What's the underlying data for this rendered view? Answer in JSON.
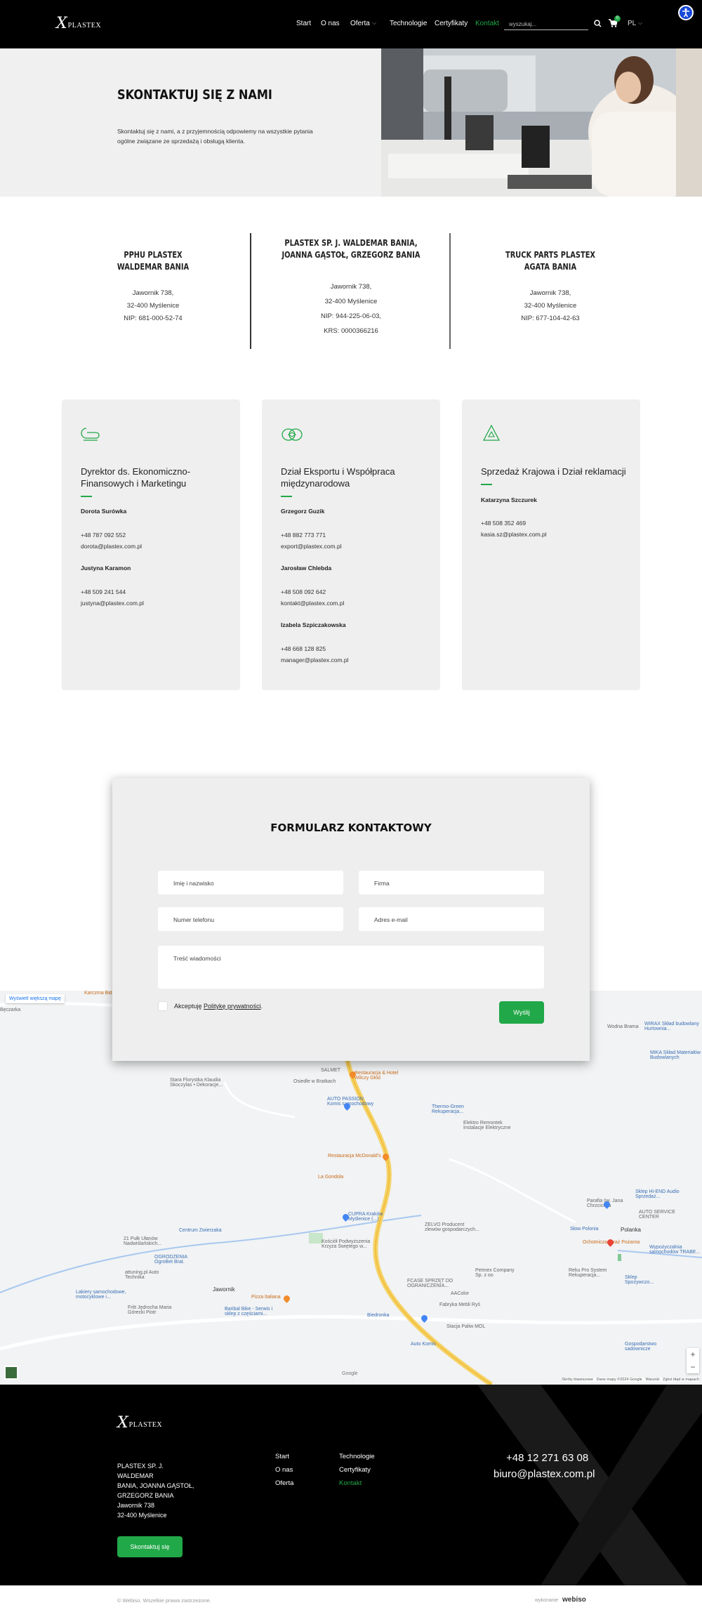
{
  "header": {
    "logo_mark": "X",
    "logo_text": "PLASTEX",
    "nav": [
      "Start",
      "O nas",
      "Oferta",
      "Technologie",
      "Certyfikaty",
      "Kontakt"
    ],
    "search_placeholder": "wyszukaj...",
    "cart_count": "0",
    "lang": "PL"
  },
  "hero": {
    "title": "SKONTAKTUJ SIĘ Z NAMI",
    "text": "Skontaktuj się z nami, a z przyjemnością odpowiemy na wszystkie pytania ogólne związane ze sprzedażą i obsługą klienta."
  },
  "companies": [
    {
      "title": [
        "PPHU PLASTEX",
        "WALDEMAR BANIA"
      ],
      "lines": [
        "Jawornik  738,",
        "32-400 Myślenice",
        "NIP: 681-000-52-74"
      ]
    },
    {
      "title": [
        "PLASTEX SP. J. WALDEMAR BANIA,",
        "JOANNA GĄSTOŁ, GRZEGORZ BANIA"
      ],
      "lines": [
        "Jawornik  738,",
        "32-400 Myślenice",
        "NIP: 944-225-06-03,",
        "KRS: 0000366216"
      ]
    },
    {
      "title": [
        "TRUCK PARTS PLASTEX",
        "AGATA BANIA"
      ],
      "lines": [
        "Jawornik  738,",
        "32-400 Myślenice",
        "NIP: 677-104-42-63"
      ]
    }
  ],
  "departments": [
    {
      "icon": "coin-icon",
      "title": [
        "Dyrektor ds. Ekonomiczno-",
        "Finansowych i Marketingu"
      ],
      "people": [
        {
          "name": "Dorota Surówka",
          "phone": "+48 787 092 552",
          "email": "dorota@plastex.com.pl"
        },
        {
          "name": "Justyna Karamon",
          "phone": "+48 509 241 544",
          "email": "justyna@plastex.com.pl"
        }
      ]
    },
    {
      "icon": "handshake-icon",
      "title": [
        "Dział Eksportu i Współpraca",
        "międzynarodowa"
      ],
      "people": [
        {
          "name": "Grzegorz Guzik",
          "phone": "+48 882 773 771",
          "email": "export@plastex.com.pl"
        },
        {
          "name": "Jarosław Chlebda",
          "phone": "+48 508 092 642",
          "email": "kontakt@plastex.com.pl"
        },
        {
          "name": "Izabela Szpiczakowska",
          "phone": "+48 668 128 825",
          "email": "manager@plastex.com.pl"
        }
      ]
    },
    {
      "icon": "recycle-icon",
      "title": [
        "Sprzedaż Krajowa i Dział reklamacji"
      ],
      "people": [
        {
          "name": "Katarzyna Szczurek",
          "phone": "+48 508 352 469",
          "email": "kasia.sz@plastex.com.pl"
        }
      ]
    }
  ],
  "form": {
    "title": "FORMULARZ KONTAKTOWY",
    "name_ph": "Imię i nazwisko",
    "company_ph": "Firma",
    "phone_ph": "Numer telefonu",
    "email_ph": "Adres e-mail",
    "message_ph": "Treść wiadomości",
    "accept_prefix": "Akceptuję ",
    "accept_link": "Politykę prywatności",
    "accept_suffix": ".",
    "submit": "Wyślij"
  },
  "map": {
    "larger_map": "Wyświetl większą mapę",
    "labels": [
      {
        "t": "Karczma Bid",
        "c": "org"
      },
      {
        "t": "Bęczarka",
        "c": ""
      },
      {
        "t": "SALMET",
        "c": ""
      },
      {
        "t": "Stara Florystka Klaudia Skoczylas • Dekoracje...",
        "c": ""
      },
      {
        "t": "Osiedle w Bratkach",
        "c": ""
      },
      {
        "t": "Restauracja & Hotel Wilczy Głód",
        "c": "org"
      },
      {
        "t": "AUTO PASSION Komis samochodowy",
        "c": "blue"
      },
      {
        "t": "Thermo-Green Rekuperacja...",
        "c": "blue"
      },
      {
        "t": "Elektro Remontek Instalacje Elektryczne",
        "c": ""
      },
      {
        "t": "Restauracja McDonald's",
        "c": "org"
      },
      {
        "t": "La Gondola",
        "c": "org"
      },
      {
        "t": "CUPRA Kraków Myślenice (...)",
        "c": "blue"
      },
      {
        "t": "Kościół Podwyższenia Krzyża Świętego w...",
        "c": ""
      },
      {
        "t": "ZELVO Producent zlewów gospodarczych...",
        "c": ""
      },
      {
        "t": "Centrum Zwierzaka",
        "c": "blue"
      },
      {
        "t": "21 Pułk Ułanów Nadwiślańskich...",
        "c": ""
      },
      {
        "t": "OGRODZENIA OgroBet Brat.",
        "c": "blue"
      },
      {
        "t": "attuning.pl Auto Technika",
        "c": ""
      },
      {
        "t": "Lakiery samochodowe, motocyklowe i...",
        "c": "blue"
      },
      {
        "t": "Jawornik",
        "c": ""
      },
      {
        "t": "Pizza Italiana",
        "c": "org"
      },
      {
        "t": "Fritt Jędrocha Maria Górecki Piotr",
        "c": ""
      },
      {
        "t": "Baribal Bike - Serwis i sklep z częściami...",
        "c": "blue"
      },
      {
        "t": "FCASE SPRZĘT DO OGRANICZENIA...",
        "c": ""
      },
      {
        "t": "Petmex Company Sp. z oo",
        "c": ""
      },
      {
        "t": "AAColor",
        "c": ""
      },
      {
        "t": "Fabryka Mebli Ryś",
        "c": ""
      },
      {
        "t": "Stacja Paliw MOL",
        "c": ""
      },
      {
        "t": "Biedronka",
        "c": "blue"
      },
      {
        "t": "Auto Komis",
        "c": "blue"
      },
      {
        "t": "Sklep Hi-END Audio Sprzedaż...",
        "c": "blue"
      },
      {
        "t": "Parafia św. Jana Chrzciciela",
        "c": ""
      },
      {
        "t": "AUTO SERVICE CENTER",
        "c": ""
      },
      {
        "t": "Słow Polonia",
        "c": "blue"
      },
      {
        "t": "Ochotnicza Straż Pożarna",
        "c": "org"
      },
      {
        "t": "Polanka",
        "c": ""
      },
      {
        "t": "Wypożyczalnia samochodów TRABE...",
        "c": "blue"
      },
      {
        "t": "Reku Pro System Rekuperacja...",
        "c": ""
      },
      {
        "t": "Sklep Spożywczo...",
        "c": "blue"
      },
      {
        "t": "Gospodarstwo sadownicze",
        "c": "blue"
      },
      {
        "t": "WIRAX Skład budowlany Hurtownia...",
        "c": "blue"
      },
      {
        "t": "MIKA Skład Materiałów Budowlanych",
        "c": "blue"
      },
      {
        "t": "Wodna Brama",
        "c": ""
      },
      {
        "t": "Google",
        "c": ""
      }
    ],
    "footer_links": [
      "Skróty klawiszowe",
      "Dane mapy ©2024 Google",
      "Warunki",
      "Zgłoś błąd w mapach"
    ]
  },
  "footer": {
    "address": [
      "PLASTEX SP. J. WALDEMAR",
      "BANIA, JOANNA GĄSTOŁ,",
      "GRZEGORZ BANIA",
      "Jawornik 738",
      "32-400 Myślenice"
    ],
    "nav_col1": [
      "Start",
      "O nas",
      "Oferta"
    ],
    "nav_col2": [
      "Technologie",
      "Certyfikaty",
      "Kontakt"
    ],
    "phone": "+48 12 271 63 08",
    "email": "biuro@plastex.com.pl",
    "cta": "Skontaktuj się"
  },
  "bottom": {
    "copyright": "© Webiso. Wszelkie prawa zastrzeżone.",
    "made_by": "wykonanie",
    "brand": "webiso"
  },
  "colors": {
    "accent": "#21a848",
    "dark": "#000000",
    "card": "#efefef"
  }
}
